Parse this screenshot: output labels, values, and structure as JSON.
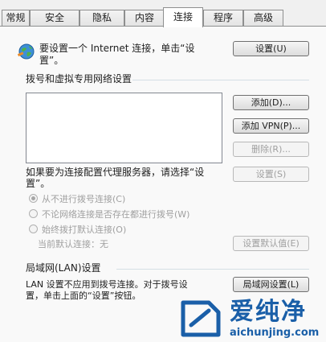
{
  "tabs": [
    {
      "label": "常规"
    },
    {
      "label": "安全"
    },
    {
      "label": "隐私"
    },
    {
      "label": "内容"
    },
    {
      "label": "连接"
    },
    {
      "label": "程序"
    },
    {
      "label": "高级"
    }
  ],
  "active_tab": "连接",
  "setup": {
    "text_line1": "要设置一个 Internet 连接，单击“设",
    "text_line2": "置”。",
    "button": "设置(U)"
  },
  "dialup": {
    "heading": "拨号和虚拟专用网络设置",
    "add_button": "添加(D)...",
    "add_vpn_button": "添加 VPN(P)...",
    "remove_button": "删除(R)...",
    "proxy_text_line1": "如果要为连接配置代理服务器，请选择“设",
    "proxy_text_line2": "置”。",
    "settings_button": "设置(S)",
    "radio_never": "从不进行拨号连接(C)",
    "radio_when_no_network": "不论网络连接是否存在都进行拨号(W)",
    "radio_always": "始终拨打默认连接(O)",
    "current_default_label": "当前默认连接：",
    "current_default_value": "无",
    "set_default_button": "设置默认值(E)"
  },
  "lan": {
    "heading": "局域网(LAN)设置",
    "text_line1": "LAN 设置不应用到拨号连接。对于拨号设",
    "text_line2": "置，单击上面的“设置”按钮。",
    "button": "局域网设置(L)"
  },
  "watermark": {
    "brand": "爱纯净",
    "url": "aichunjing.com"
  },
  "colors": {
    "logo_blue": "#1a5fa8"
  }
}
